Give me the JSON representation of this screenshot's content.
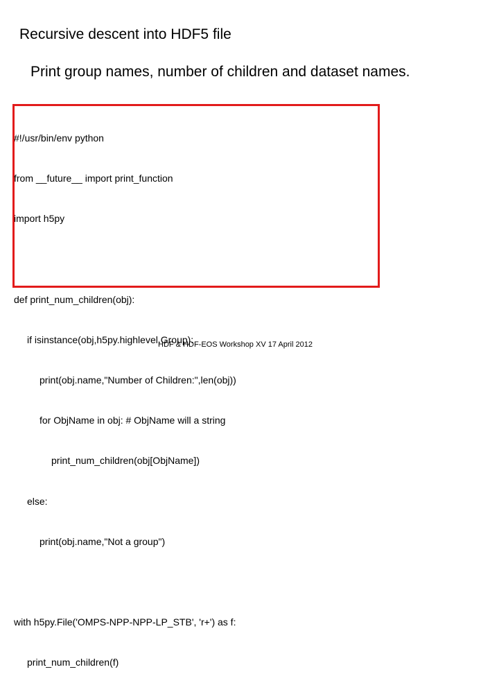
{
  "slide": {
    "title": "Recursive descent into HDF5 file",
    "subtitle": "Print group names, number of children and dataset names.",
    "code": {
      "line1": "#!/usr/bin/env python",
      "line2": "from __future__ import print_function",
      "line3": "import h5py",
      "line4": "def print_num_children(obj):",
      "line5": "if isinstance(obj,h5py.highlevel.Group):",
      "line6": "print(obj.name,\"Number of Children:\",len(obj))",
      "line7": "for ObjName in obj: # ObjName will a string",
      "line8": "print_num_children(obj[ObjName])",
      "line9": "else:",
      "line10": "print(obj.name,\"Not a group\")",
      "line11": "with h5py.File('OMPS-NPP-NPP-LP_STB', 'r+') as f:",
      "line12": "print_num_children(f)"
    },
    "footer": "HDF & HDF-EOS Workshop XV 17 April 2012"
  },
  "colors": {
    "code_border": "#e21b1b",
    "text": "#000000",
    "background": "#ffffff"
  }
}
